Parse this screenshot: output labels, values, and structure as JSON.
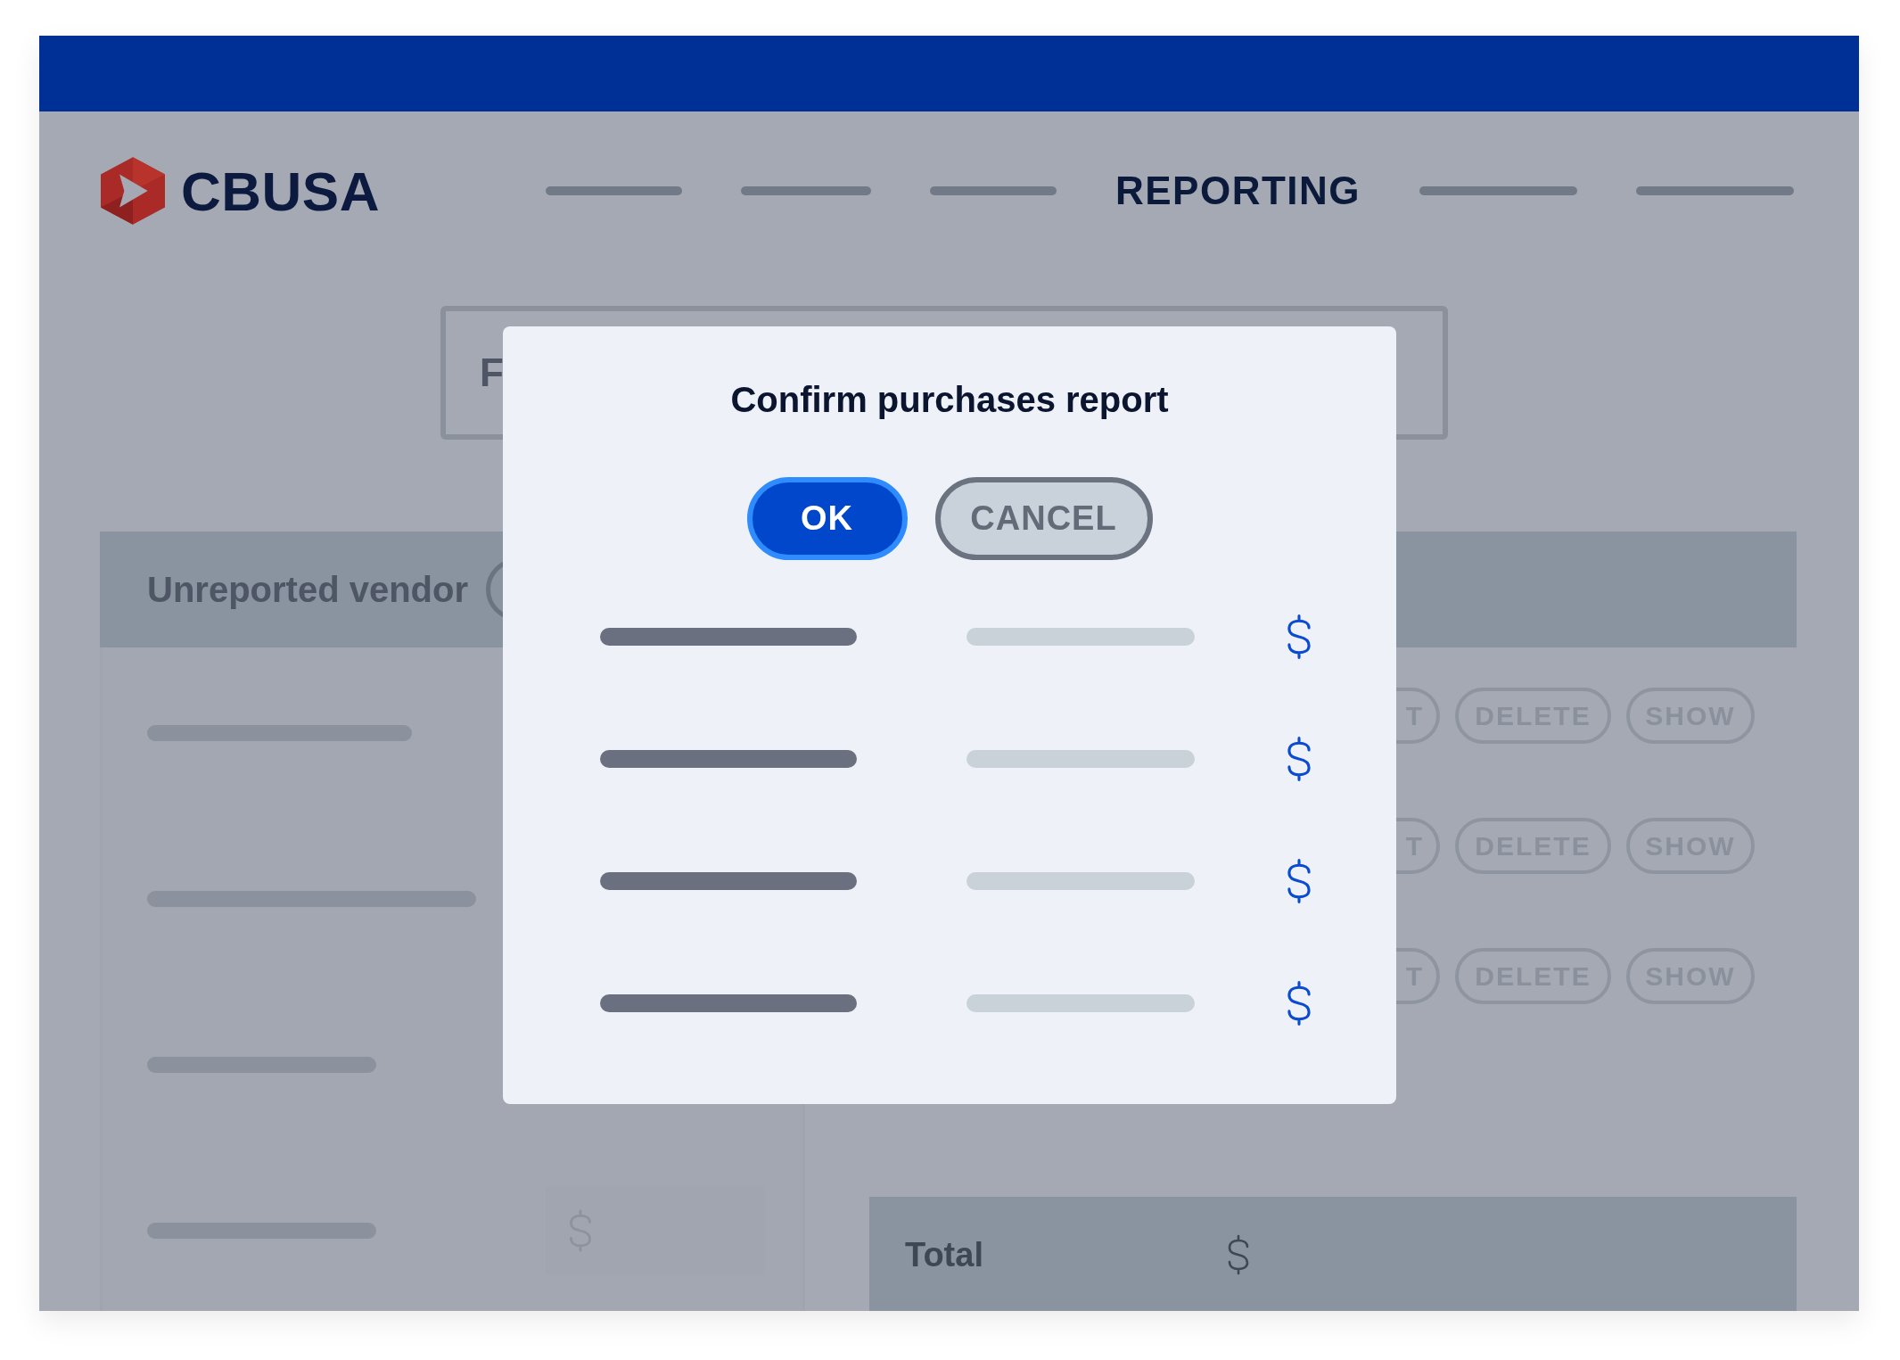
{
  "header": {
    "logo_text": "CBUSA",
    "nav_items": [
      {
        "kind": "placeholder"
      },
      {
        "kind": "placeholder"
      },
      {
        "kind": "placeholder"
      },
      {
        "kind": "text",
        "label": "REPORTING"
      },
      {
        "kind": "placeholder"
      },
      {
        "kind": "placeholder"
      }
    ]
  },
  "search_field": {
    "value": "F"
  },
  "vendor_panel": {
    "title": "Unreported vendor",
    "rows": [
      {
        "kind": "line"
      },
      {
        "kind": "line"
      },
      {
        "kind": "line"
      },
      {
        "kind": "line_with_amount"
      }
    ]
  },
  "action_rows": [
    {
      "buttons": [
        {
          "label": "T",
          "kind": "cut"
        },
        {
          "label": "DELETE",
          "kind": "full"
        },
        {
          "label": "SHOW",
          "kind": "full"
        }
      ]
    },
    {
      "buttons": [
        {
          "label": "T",
          "kind": "cut"
        },
        {
          "label": "DELETE",
          "kind": "full"
        },
        {
          "label": "SHOW",
          "kind": "full"
        }
      ]
    },
    {
      "buttons": [
        {
          "label": "T",
          "kind": "cut"
        },
        {
          "label": "DELETE",
          "kind": "full"
        },
        {
          "label": "SHOW",
          "kind": "full"
        }
      ]
    }
  ],
  "total": {
    "label": "Total"
  },
  "dialog": {
    "title": "Confirm purchases report",
    "buttons": [
      {
        "label": "OK",
        "kind": "primary"
      },
      {
        "label": "CANCEL",
        "kind": "secondary"
      }
    ],
    "rows": [
      {
        "kind": "placeholder"
      },
      {
        "kind": "placeholder"
      },
      {
        "kind": "placeholder"
      },
      {
        "kind": "placeholder"
      }
    ]
  }
}
